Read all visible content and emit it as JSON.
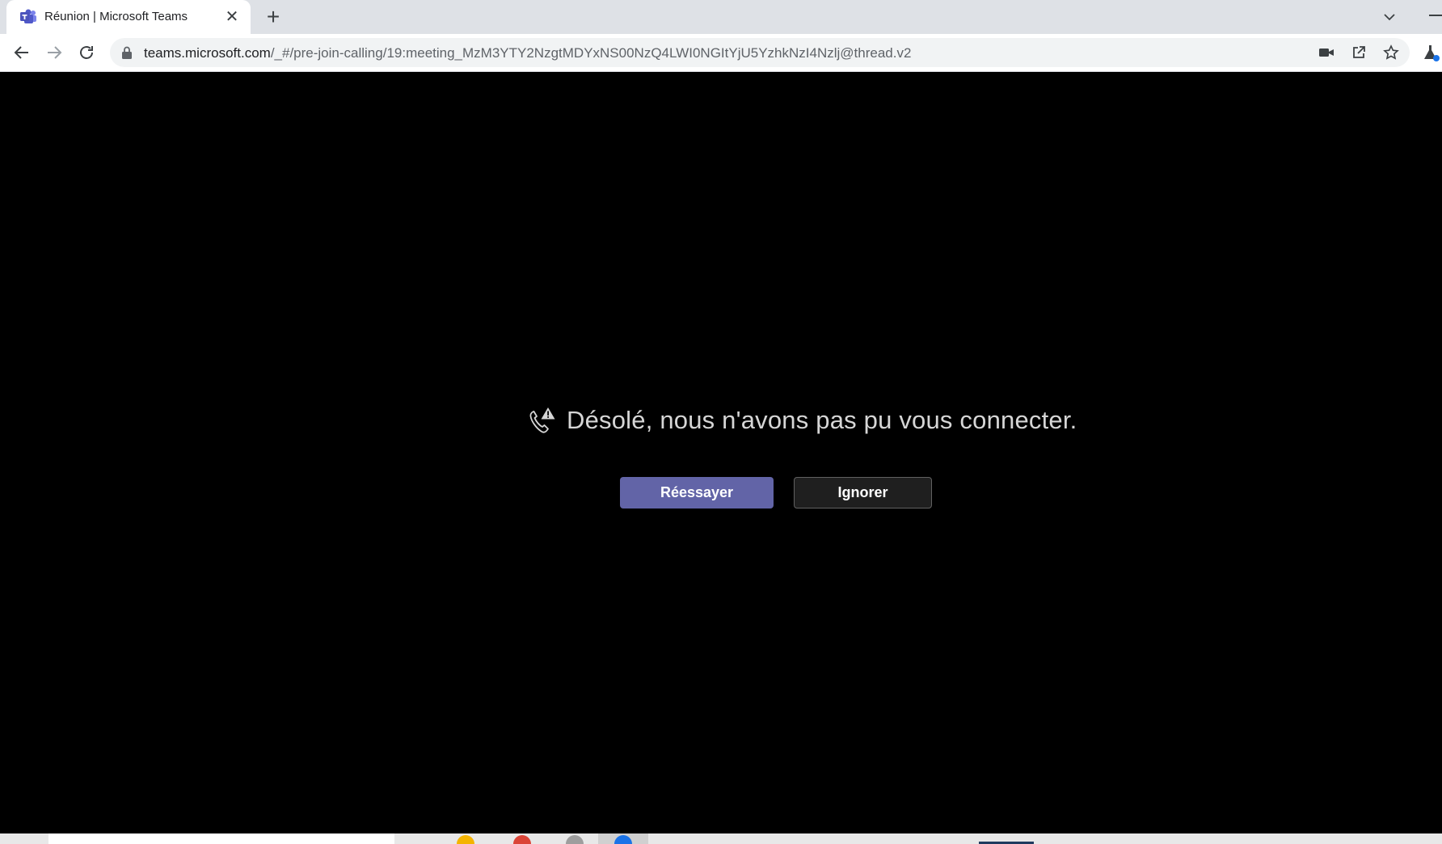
{
  "browser": {
    "tab": {
      "title": "Réunion | Microsoft Teams",
      "favicon": "teams-icon",
      "close_label": "✕"
    },
    "new_tab_label": "+",
    "address": {
      "host": "teams.microsoft.com",
      "path": "/_#/pre-join-calling/19:meeting_MzM3YTY2NzgtMDYxNS00NzQ4LWI0NGItYjU5YzhkNzI4Nzlj@thread.v2"
    },
    "icons": [
      "back-icon",
      "forward-icon",
      "reload-icon",
      "lock-icon",
      "camera-icon",
      "share-icon",
      "star-icon",
      "labs-icon"
    ]
  },
  "meeting": {
    "error_message": "Désolé, nous n'avons pas pu vous connecter.",
    "icon": "call-warning-icon",
    "retry_label": "Réessayer",
    "ignore_label": "Ignorer"
  },
  "colors": {
    "accent": "#6264a7",
    "background": "#000000",
    "message_text": "#d6d6d6"
  }
}
